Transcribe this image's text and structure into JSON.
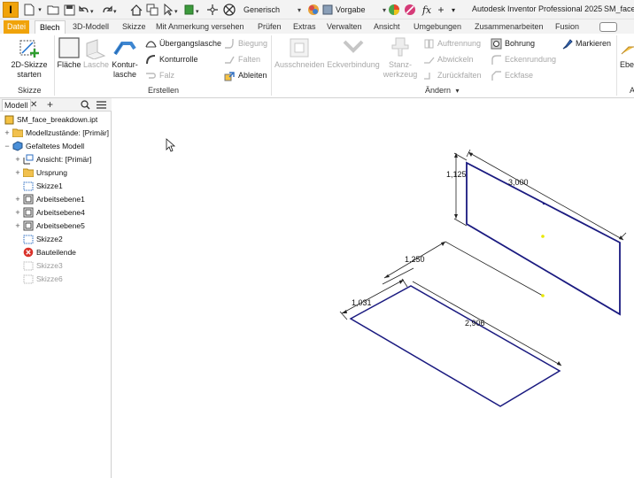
{
  "titlebar": {
    "app_logo_letter": "I",
    "appearance_combo": "Generisch",
    "material_combo": "Vorgabe",
    "app_title": "Autodesk Inventor Professional 2025",
    "doc_title": "SM_face"
  },
  "tabs": [
    "Datei",
    "Blech",
    "3D-Modell",
    "Skizze",
    "Mit Anmerkung versehen",
    "Prüfen",
    "Extras",
    "Verwalten",
    "Ansicht",
    "Umgebungen",
    "Zusammenarbeiten",
    "Fusion"
  ],
  "active_tab": "Blech",
  "ribbon": {
    "skizze_panel": {
      "title": "Skizze",
      "button": {
        "line1": "2D-Skizze",
        "line2": "starten"
      }
    },
    "erstellen_panel": {
      "title": "Erstellen",
      "flaeche": "Fläche",
      "lasche": "Lasche",
      "konturlasche_line1": "Kontur-",
      "konturlasche_line2": "lasche",
      "uebergangslasche": "Übergangslasche",
      "konturrolle": "Konturrolle",
      "falz": "Falz",
      "biegung": "Biegung",
      "falten": "Falten",
      "ableiten": "Ableiten"
    },
    "aendern_panel": {
      "title": "Ändern",
      "ausschneiden": "Ausschneiden",
      "eckverbindung": "Eckverbindung",
      "stanzwerkzeug_line1": "Stanz-",
      "stanzwerkzeug_line2": "werkzeug",
      "auftrennung": "Auftrennung",
      "abwickeln": "Abwickeln",
      "zurueckfalten": "Zurückfalten",
      "bohrung": "Bohrung",
      "eckenrundung": "Eckenrundung",
      "eckfase": "Eckfase",
      "markieren": "Markieren"
    },
    "extra_panel": {
      "label": "Ebe",
      "title": "A"
    }
  },
  "browser": {
    "tab_label": "Modell",
    "tree": [
      {
        "label": "SM_face_breakdown.ipt",
        "icon": "part-file-icon",
        "expander": "",
        "dim": false
      },
      {
        "label": "Modellzustände: [Primär]",
        "icon": "folder-icon",
        "expander": "+",
        "dim": false
      },
      {
        "label": "Gefaltetes Modell",
        "icon": "sheet-metal-icon",
        "expander": "−",
        "dim": false
      },
      {
        "label": "Ansicht: [Primär]",
        "icon": "view-icon",
        "expander": "+",
        "dim": false
      },
      {
        "label": "Ursprung",
        "icon": "folder-icon",
        "expander": "+",
        "dim": false
      },
      {
        "label": "Skizze1",
        "icon": "sketch-icon",
        "expander": "",
        "dim": false
      },
      {
        "label": "Arbeitsebene1",
        "icon": "work-plane-icon",
        "expander": "+",
        "dim": false
      },
      {
        "label": "Arbeitsebene4",
        "icon": "work-plane-icon",
        "expander": "+",
        "dim": false
      },
      {
        "label": "Arbeitsebene5",
        "icon": "work-plane-icon",
        "expander": "+",
        "dim": false
      },
      {
        "label": "Skizze2",
        "icon": "sketch-icon",
        "expander": "",
        "dim": false
      },
      {
        "label": "Bauteilende",
        "icon": "end-of-part-icon",
        "expander": "",
        "dim": false
      },
      {
        "label": "Skizze3",
        "icon": "sketch-icon",
        "expander": "",
        "dim": true
      },
      {
        "label": "Skizze6",
        "icon": "sketch-icon",
        "expander": "",
        "dim": true
      }
    ]
  },
  "viewport": {
    "dimensions": [
      "1,125",
      "3,000",
      "1,250",
      "1,031",
      "2,906"
    ],
    "colors": {
      "sketch_line": "#1a1a80",
      "point": "#e8e800",
      "accent": "#f0a30a"
    }
  }
}
